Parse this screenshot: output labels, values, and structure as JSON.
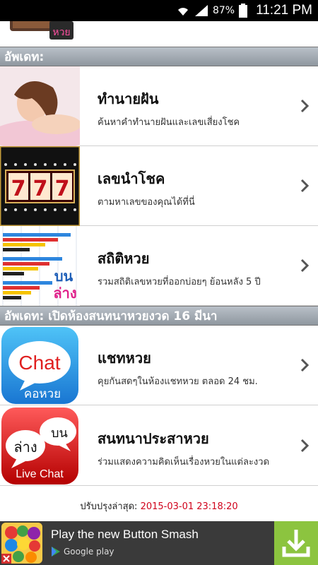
{
  "status_bar": {
    "battery": "87%",
    "time": "11:21 PM"
  },
  "top_partial": {
    "badge": "หวย"
  },
  "section1": {
    "header": "อัพเดท:"
  },
  "section2": {
    "header": "อัพเดท: เปิดห้องสนทนาหวยงวด 16 มีนา"
  },
  "items": [
    {
      "title": "ทำนายฝัน",
      "subtitle": "ค้นหาคำทำนายฝันและเลขเสี่ยงโชค"
    },
    {
      "title": "เลขนำโชค",
      "subtitle": "ตามหาเลขของคุณได้ที่นี่",
      "slot_digits": "777"
    },
    {
      "title": "สถิติหวย",
      "subtitle": "รวมสถิติเลขหวยที่ออกบ่อยๆ ย้อนหลัง 5 ปี",
      "icon_top": "บน",
      "icon_bottom": "ล่าง"
    },
    {
      "title": "แชทหวย",
      "subtitle": "คุยกันสดๆในห้องแชทหวย ตลอด 24 ชม.",
      "icon_bubble": "Chat",
      "icon_caption": "คอหวย"
    },
    {
      "title": "สนทนาประสาหวย",
      "subtitle": "ร่วมแสดงความคิดเห็นเรื่องหวยในแต่ละงวด",
      "icon_left": "ล่าง",
      "icon_right": "บน",
      "icon_caption": "Live Chat"
    }
  ],
  "footer": {
    "updated_label": "ปรับปรุงล่าสุด:",
    "updated_value": "2015-03-01 23:18:20"
  },
  "ad": {
    "text": "Play the new Button Smash",
    "store": "Google play"
  },
  "colors": {
    "header_bg": "#a3abb3",
    "timestamp": "#d0021b",
    "ad_bg": "#3a3a3a",
    "download_green": "#8cc43f"
  }
}
